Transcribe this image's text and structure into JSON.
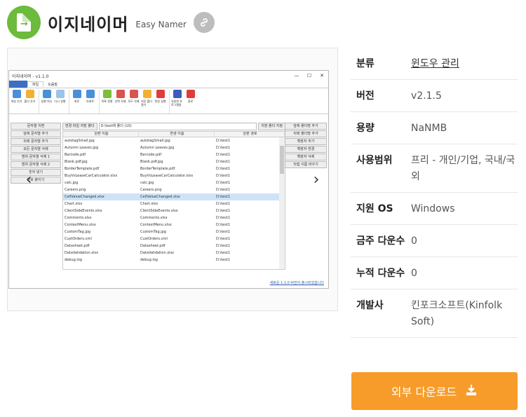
{
  "header": {
    "title": "이지네이머",
    "subtitle": "Easy Namer"
  },
  "window": {
    "title": "이지네이머 - v1.1.0",
    "tabs": [
      "파일",
      "도움말"
    ],
    "ribbon": [
      {
        "label": "파일 추가",
        "color": "#4a90d9"
      },
      {
        "label": "폴더 추가",
        "color": "#f2b134"
      },
      {
        "label": "실행 취소",
        "color": "#4a90d9"
      },
      {
        "label": "다시 실행",
        "color": "#9ec3ea"
      },
      {
        "label": "위로",
        "color": "#4a90d9"
      },
      {
        "label": "아래로",
        "color": "#4a90d9"
      },
      {
        "label": "목록 정렬",
        "color": "#7bbf3a"
      },
      {
        "label": "선택 삭제",
        "color": "#d9534f"
      },
      {
        "label": "모두 삭제",
        "color": "#d9534f"
      },
      {
        "label": "저장 폴더 열기",
        "color": "#f2b134"
      },
      {
        "label": "변경 실행",
        "color": "#e03b3b"
      },
      {
        "label": "유용한 프로그램들",
        "color": "#3b5bbf"
      },
      {
        "label": "종료",
        "color": "#e03b3b"
      }
    ],
    "left_buttons": [
      "문자열 치환",
      "앞에 문자열 추가",
      "뒤에 문자열 추가",
      "모든 문자열 삭제",
      "범위 문자열 삭제 1",
      "범위 문자열 삭제 2",
      "숫자 넣기",
      "번호 붙이기"
    ],
    "right_buttons": [
      "앞에 폴더명 추가",
      "뒤에 폴더명 추가",
      "확장자 추가",
      "확장자 변경",
      "확장자 삭제",
      "직접 이름 바꾸기"
    ],
    "path_label": "변경 파일 저장 폴더",
    "path_value": "D:\\test에 폴더 (10)",
    "path_button": "저장 폴더 지정",
    "columns": [
      "원본 이름",
      "변경 이름",
      "원본 경로"
    ],
    "rows": [
      [
        "autotagSmall.jpg",
        "autotagSmall.jpg",
        "D:\\test1"
      ],
      [
        "Autumn Leaves.jpg",
        "Autumn Leaves.jpg",
        "D:\\test1"
      ],
      [
        "Barcode.pdf",
        "Barcode.pdf",
        "D:\\test1"
      ],
      [
        "Blank.pdf.jpg",
        "Blank.pdf.jpg",
        "D:\\test1"
      ],
      [
        "BorderTemplate.pdf",
        "BorderTemplate.pdf",
        "D:\\test1"
      ],
      [
        "BuyVsLeaseCarCalculator.xlsx",
        "BuyVsLeaseCarCalculator.xlsx",
        "D:\\test1"
      ],
      [
        "calc.jpg",
        "calc.jpg",
        "D:\\test1"
      ],
      [
        "Careers.png",
        "Careers.png",
        "D:\\test1"
      ],
      [
        "CellValueChanged.xlsx",
        "CellValueChanged.xlsx",
        "D:\\test1"
      ],
      [
        "Chart.xlsx",
        "Chart.xlsx",
        "D:\\test1"
      ],
      [
        "ClientSideEvents.xlsx",
        "ClientSideEvents.xlsx",
        "D:\\test1"
      ],
      [
        "Comments.xlsx",
        "Comments.xlsx",
        "D:\\test1"
      ],
      [
        "ContextMenu.xlsx",
        "ContextMenu.xlsx",
        "D:\\test1"
      ],
      [
        "CustomTag.jpg",
        "CustomTag.jpg",
        "D:\\test1"
      ],
      [
        "CustOrders.xml",
        "CustOrders.xml",
        "D:\\test1"
      ],
      [
        "Datasheet.pdf",
        "Datasheet.pdf",
        "D:\\test1"
      ],
      [
        "DataValidation.xlsx",
        "DataValidation.xlsx",
        "D:\\test1"
      ],
      [
        "debug.log",
        "debug.log",
        "D:\\test1"
      ]
    ],
    "selected_row": 8,
    "status_link": "새로운 1.1.0 버전이 출시되었습니다"
  },
  "info": [
    {
      "k": "분류",
      "v": "윈도우 관리",
      "link": true
    },
    {
      "k": "버전",
      "v": "v2.1.5"
    },
    {
      "k": "용량",
      "v": "NaNMB"
    },
    {
      "k": "사용범위",
      "v": "프리 - 개인/기업, 국내/국외"
    },
    {
      "k": "지원 OS",
      "v": "Windows"
    },
    {
      "k": "금주 다운수",
      "v": "0"
    },
    {
      "k": "누적 다운수",
      "v": "0"
    },
    {
      "k": "개발사",
      "v": "킨포크소프트(Kinfolk Soft)"
    }
  ],
  "download_label": "외부 다운로드",
  "icons": {
    "logo": "file-arrow-icon",
    "link": "link-icon",
    "download": "download-icon",
    "prev": "chevron-left-icon",
    "next": "chevron-right-icon"
  }
}
